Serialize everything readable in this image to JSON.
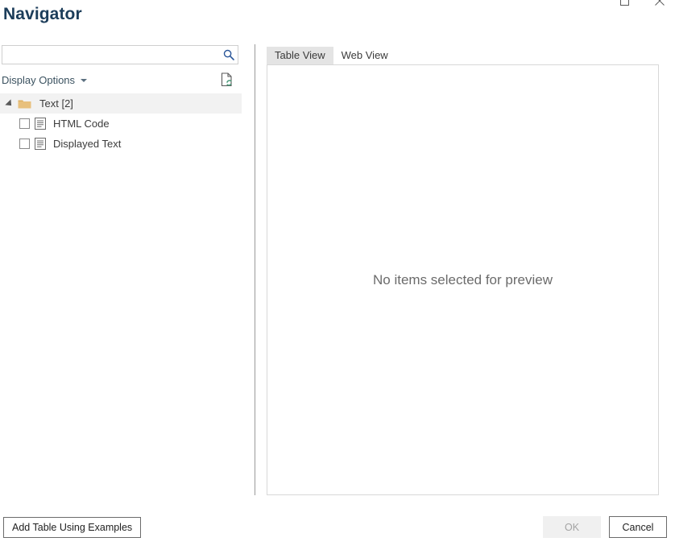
{
  "window": {
    "title": "Navigator",
    "controls": [
      {
        "name": "maximize",
        "glyph": "maximize-icon"
      },
      {
        "name": "close",
        "glyph": "close-icon"
      }
    ]
  },
  "search": {
    "value": "",
    "placeholder": "",
    "icon": "search-icon"
  },
  "options": {
    "label": "Display Options",
    "caret": "chevron-down-icon",
    "refresh_icon": "refresh-document-icon"
  },
  "tree": {
    "group": {
      "label": "Text [2]",
      "expanded": true,
      "icon": "folder-icon",
      "expander": "triangle-expanded-icon"
    },
    "items": [
      {
        "label": "HTML Code",
        "checked": false,
        "icon": "table-icon"
      },
      {
        "label": "Displayed Text",
        "checked": false,
        "icon": "table-icon"
      }
    ]
  },
  "preview": {
    "tabs": [
      {
        "label": "Table View",
        "active": true
      },
      {
        "label": "Web View",
        "active": false
      }
    ],
    "empty_message": "No items selected for preview"
  },
  "footer": {
    "add_table_label": "Add Table Using Examples",
    "ok_label": "OK",
    "ok_enabled": false,
    "cancel_label": "Cancel"
  },
  "colors": {
    "title": "#1c3d5a",
    "accent_search": "#2a5699",
    "folder": "#e8c07d",
    "row_highlight": "#f2f2f2",
    "tab_active": "#e4e4e4",
    "refresh_green": "#4c9a7a"
  }
}
